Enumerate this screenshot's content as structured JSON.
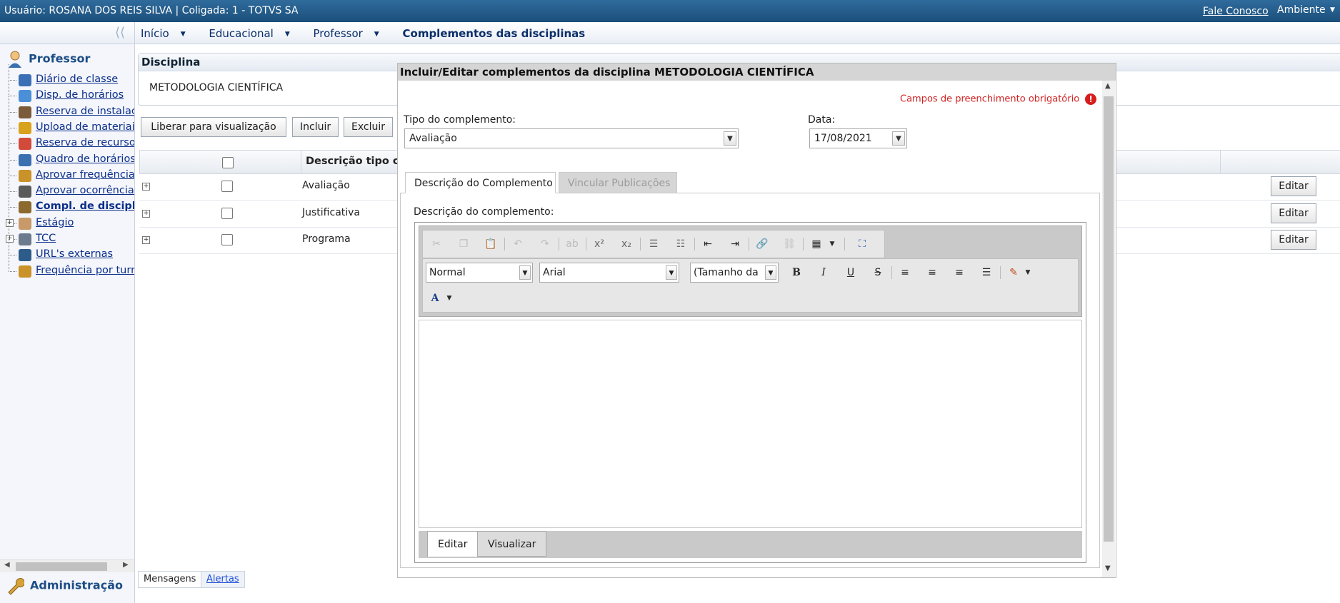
{
  "topbar": {
    "user_text": "Usuário: ROSANA DOS REIS SILVA  |  Coligada: 1 - TOTVS SA",
    "fale_conosco": "Fale Conosco",
    "ambiente": "Ambiente"
  },
  "breadcrumb": {
    "collapse_glyph": "⟨⟨",
    "items": [
      "Início",
      "Educacional",
      "Professor"
    ],
    "current": "Complementos das disciplinas"
  },
  "sidebar": {
    "header": "Professor",
    "items": [
      {
        "label": "Diário de classe",
        "icon": "book-icon",
        "color": "#3b6fb5"
      },
      {
        "label": "Disp. de horários",
        "icon": "calendar-icon",
        "color": "#4a8fd8"
      },
      {
        "label": "Reserva de instalaçõ",
        "icon": "building-icon",
        "color": "#7b5b3a"
      },
      {
        "label": "Upload de materiais",
        "icon": "upload-icon",
        "color": "#d9a21c"
      },
      {
        "label": "Reserva de recursos",
        "icon": "checklist-icon",
        "color": "#d24a3a"
      },
      {
        "label": "Quadro de horários",
        "icon": "clock-icon",
        "color": "#3a6fb0"
      },
      {
        "label": "Aprovar frequência",
        "icon": "approve-attendance-icon",
        "color": "#c9932a"
      },
      {
        "label": "Aprovar ocorrências",
        "icon": "approve-occurrence-icon",
        "color": "#5a5a5a"
      },
      {
        "label": "Compl. de disciplina",
        "icon": "complement-icon",
        "color": "#8c6a2e",
        "active": true
      },
      {
        "label": "Estágio",
        "icon": "intern-icon",
        "color": "#c89a6a",
        "expandable": true
      },
      {
        "label": "TCC",
        "icon": "document-icon",
        "color": "#6b7a8c",
        "expandable": true
      },
      {
        "label": "URL's externas",
        "icon": "globe-icon",
        "color": "#2d5b8a"
      },
      {
        "label": "Frequência por turm",
        "icon": "attendance-icon",
        "color": "#c9932a"
      }
    ],
    "admin_header": "Administração"
  },
  "discipline_panel": {
    "header": "Disciplina",
    "value": "METODOLOGIA CIENTÍFICA"
  },
  "actions": {
    "liberar": "Liberar para visualização",
    "incluir": "Incluir",
    "excluir": "Excluir"
  },
  "grid": {
    "column_header": "Descrição tipo co",
    "rows": [
      {
        "tipo": "Avaliação",
        "action": "Editar"
      },
      {
        "tipo": "Justificativa",
        "action": "Editar"
      },
      {
        "tipo": "Programa",
        "action": "Editar"
      }
    ]
  },
  "bottom_tabs": {
    "mensagens": "Mensagens",
    "alertas": "Alertas"
  },
  "modal": {
    "title": "Incluir/Editar complementos da disciplina METODOLOGIA CIENTÍFICA",
    "required_note": "Campos de preenchimento obrigatório",
    "tipo_label": "Tipo do complemento:",
    "tipo_value": "Avaliação",
    "data_label": "Data:",
    "data_value": "17/08/2021",
    "tabs": [
      "Descrição do Complemento",
      "Vincular Publicações"
    ],
    "desc_label": "Descrição do complemento:",
    "editor": {
      "format_value": "Normal",
      "font_value": "Arial",
      "size_value": "(Tamanho da",
      "mode_tabs": [
        "Editar",
        "Visualizar"
      ]
    }
  },
  "colors": {
    "topbar": "#1f5580",
    "link": "#0b2f8a",
    "required": "#d12222"
  }
}
